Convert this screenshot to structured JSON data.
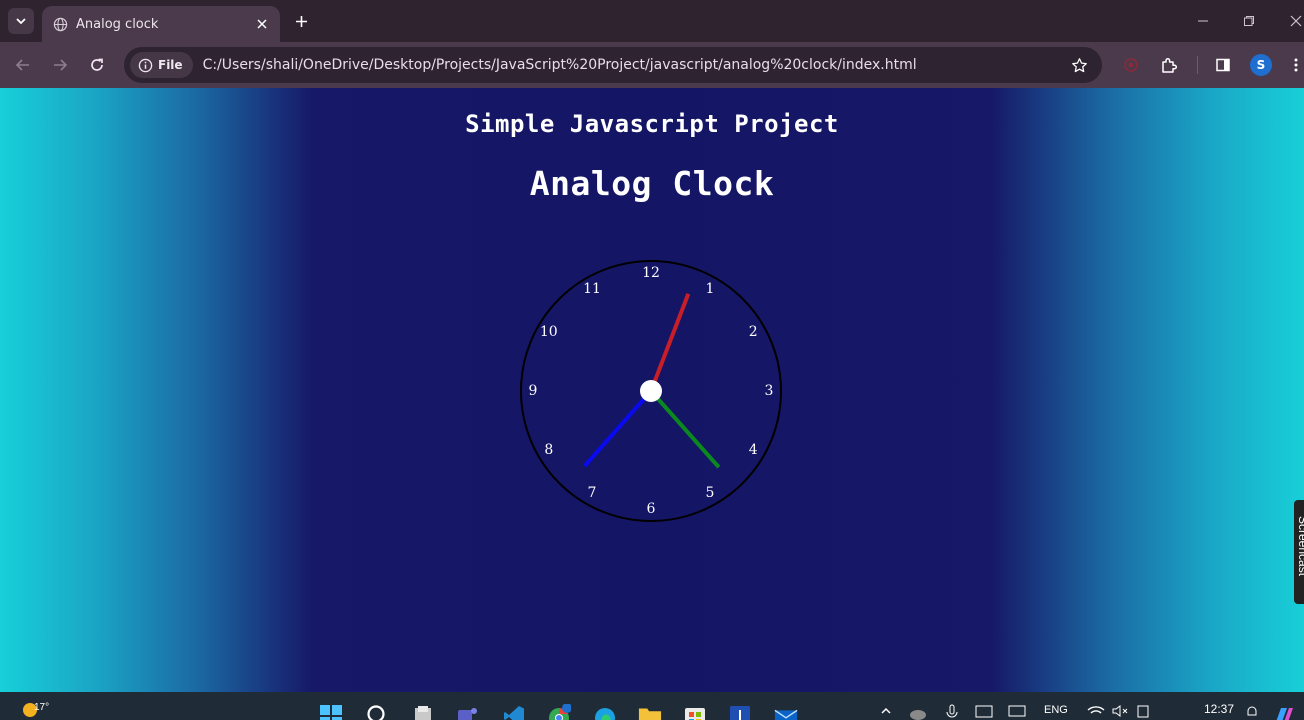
{
  "tab": {
    "title": "Analog clock"
  },
  "address_bar": {
    "chip_label": "File",
    "url": "C:/Users/shali/OneDrive/Desktop/Projects/JavaScript%20Project/javascript/analog%20clock/index.html"
  },
  "profile": {
    "initial": "S"
  },
  "page": {
    "subtitle": "Simple Javascript Project",
    "title": "Analog Clock",
    "clock": {
      "numbers": [
        "12",
        "1",
        "2",
        "3",
        "4",
        "5",
        "6",
        "7",
        "8",
        "9",
        "10",
        "11"
      ],
      "time": {
        "hours": 7,
        "minutes": 23,
        "seconds": 3.5
      },
      "colors": {
        "hour_hand": "#0a0af0",
        "minute_hand": "#0a8a1e",
        "second_hand": "#c81e28",
        "center": "#ffffff",
        "rim": "#000000"
      }
    }
  },
  "screencast_badge": "Screencast",
  "taskbar": {
    "weather_temp": "17°",
    "language": "ENG",
    "time": "12:37",
    "apps": [
      "start-icon",
      "search-icon",
      "file-app-icon",
      "teams-icon",
      "vscode-icon",
      "chrome-icon",
      "edge-icon",
      "file-explorer-icon",
      "store-icon",
      "word-icon",
      "mail-icon"
    ]
  },
  "colors": {
    "chrome_dark": "#2f2330",
    "chrome_toolbar": "#4a3a4b",
    "page_center": "#141565",
    "page_edge": "#18cfd8"
  }
}
